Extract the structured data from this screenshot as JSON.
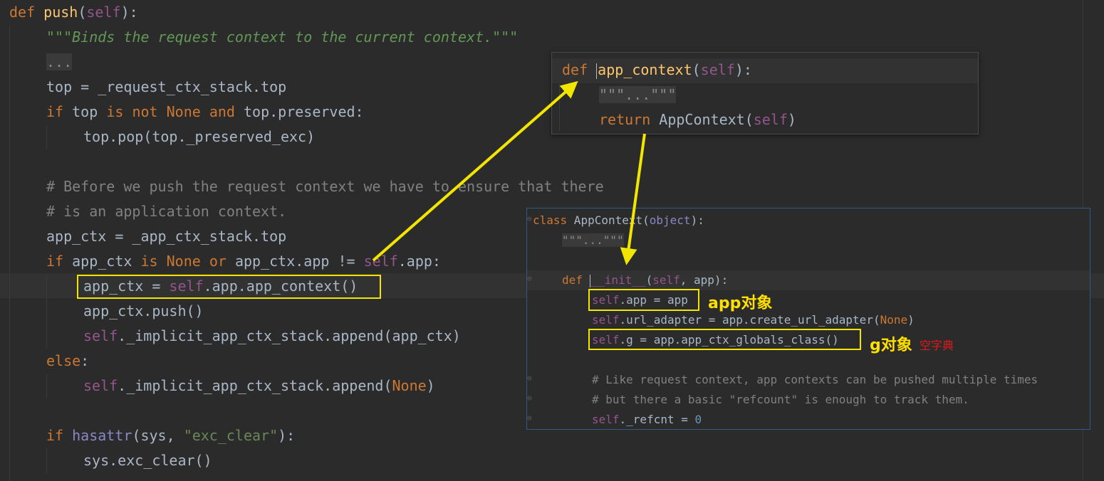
{
  "main_code": {
    "def_kw": "def",
    "func_name": "push",
    "open_paren": "(",
    "self_param": "self",
    "close_colon": "):",
    "docstring": "\"\"\"Binds the request context to the current context.\"\"\"",
    "folded": "...",
    "top_assign": "top = _request_ctx_stack.top",
    "if_kw": "if",
    "top_word": " top ",
    "is_kw": "is",
    "not_kw": "not",
    "none_kw": "None",
    "and_kw": "and",
    "preserved": " top.preserved:",
    "top_pop": "top.pop(top._preserved_exc)",
    "comment1": "# Before we push the request context we have to ensure that there",
    "comment2": "# is an application context.",
    "app_ctx_assign": "app_ctx = _app_ctx_stack.top",
    "app_ctx_word": " app_ctx ",
    "or_kw": "or",
    "app_ctx_cmp": " app_ctx.app != ",
    "self_app_colon": ".app:",
    "app_ctx_eq": "app_ctx = ",
    "self_app_call": ".app.app_context()",
    "push_call": "app_ctx.push()",
    "implicit_append": "._implicit_app_ctx_stack.append(app_ctx)",
    "else_kw": "else",
    "colon": ":",
    "implicit_append_none_a": "._implicit_app_ctx_stack.append(",
    "close_paren": ")",
    "hasattr": "hasattr",
    "sys_arg": "(sys, ",
    "exc_clear_str": "\"exc_clear\"",
    "hasattr_close": "):",
    "sys_exc_clear": "sys.exc_clear()"
  },
  "popup_app_context": {
    "def_kw": "def ",
    "func_name": "app_context",
    "args_open": "(",
    "self": "self",
    "args_close": "):",
    "folded_doc": "\"\"\"...\"\"\"",
    "return_kw": "return",
    "return_expr": " AppContext(",
    "return_close": ")"
  },
  "popup_appcontext_class": {
    "class_kw": "class",
    "class_name": " AppContext(",
    "base": "object",
    "class_close": "):",
    "folded_doc": "\"\"\"...\"\"\"",
    "def_kw": "def ",
    "init_name": "__init__",
    "init_args_open": "(",
    "init_self": "self",
    "init_args_rest": ", app):",
    "self_app_rest": ".app = app",
    "url_adapter_a": ".url_adapter = app.create_url_adapter(",
    "url_adapter_close": ")",
    "g_rest": ".g = app.app_ctx_globals_class()",
    "comment1": "# Like request context, app contexts can be pushed multiple times",
    "comment2": "# but there a basic \"refcount\" is enough to track them.",
    "refcnt_rest": "._refcnt = ",
    "refcnt_val": "0"
  },
  "annotations": {
    "app_object": "app对象",
    "g_object": "g对象",
    "empty_dict": "空字典"
  },
  "colors": {
    "highlight_box": "#f2e600",
    "arrow": "#f2e600",
    "note_red": "#e01a1a"
  }
}
